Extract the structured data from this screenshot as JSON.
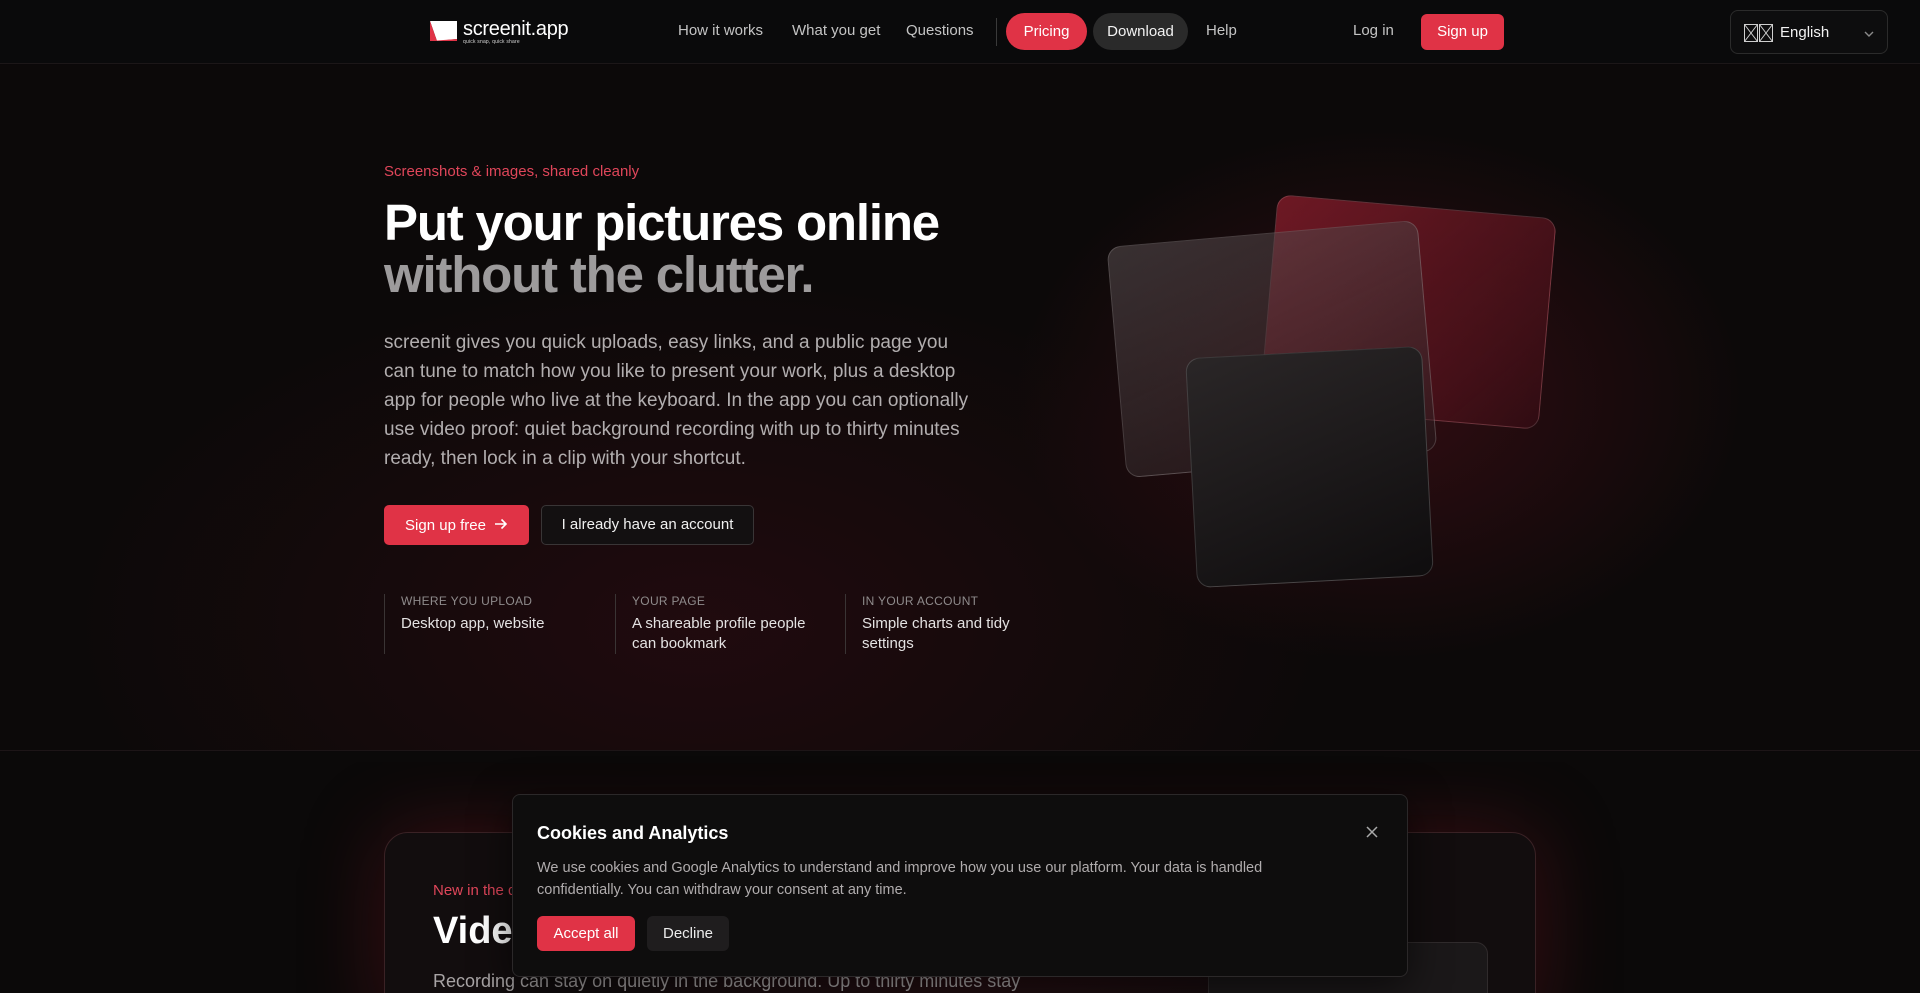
{
  "nav": {
    "logo": {
      "name": "screenit.app",
      "tagline": "quick snap, quick share"
    },
    "links": [
      "How it works",
      "What you get",
      "Questions"
    ],
    "pricing": "Pricing",
    "download": "Download",
    "help": "Help",
    "login": "Log in",
    "signup": "Sign up",
    "language": {
      "selected": "English",
      "icon": "flag-icon"
    }
  },
  "hero": {
    "eyebrow": "Screenshots & images, shared cleanly",
    "title_line1": "Put your pictures online",
    "title_line2": "without the clutter.",
    "lede": "screenit gives you quick uploads, easy links, and a public page you can tune to match how you like to present your work, plus a desktop app for people who live at the keyboard. In the app you can optionally use video proof: quiet background recording with up to thirty minutes ready, then lock in a clip with your shortcut.",
    "primary_cta": "Sign up free",
    "secondary_cta": "I already have an account",
    "features": [
      {
        "label": "Where you upload",
        "value": "Desktop app, website"
      },
      {
        "label": "Your page",
        "value": "A shareable profile people can bookmark"
      },
      {
        "label": "In your account",
        "value": "Simple charts and tidy settings"
      }
    ]
  },
  "promo": {
    "eyebrow": "New in the d",
    "title": "Vide",
    "text": "Recording can stay on quietly in the background. Up to thirty minutes stay"
  },
  "cookie": {
    "title": "Cookies and Analytics",
    "text": "We use cookies and Google Analytics to understand and improve how you use our platform. Your data is handled confidentially. You can withdraw your consent at any time.",
    "accept": "Accept all",
    "decline": "Decline"
  },
  "colors": {
    "accent": "#e03346",
    "background": "#0b0809",
    "eyebrow": "#e0465a"
  }
}
